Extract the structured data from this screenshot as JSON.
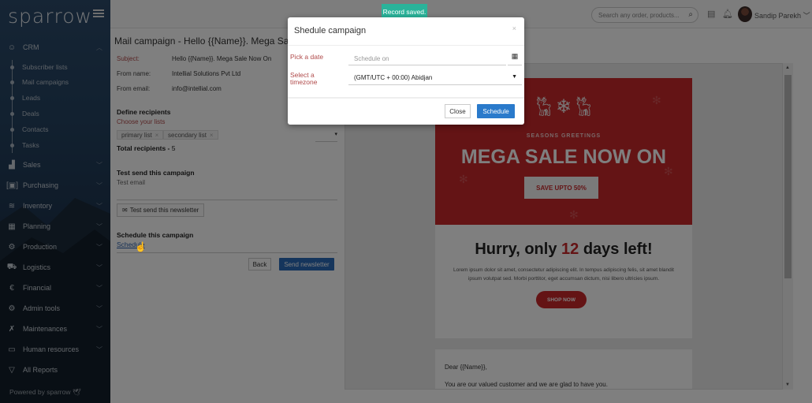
{
  "sidebar": {
    "brand": "sparrow",
    "crm": {
      "label": "CRM",
      "icon": "crm-icon"
    },
    "crm_items": [
      {
        "label": "Subscriber lists"
      },
      {
        "label": "Mail campaigns"
      },
      {
        "label": "Leads"
      },
      {
        "label": "Deals"
      },
      {
        "label": "Contacts"
      },
      {
        "label": "Tasks"
      }
    ],
    "sections": [
      {
        "label": "Sales",
        "icon": "chart-bar-icon"
      },
      {
        "label": "Purchasing",
        "icon": "barcode-scan-icon"
      },
      {
        "label": "Inventory",
        "icon": "database-icon"
      },
      {
        "label": "Planning",
        "icon": "calendar-icon"
      },
      {
        "label": "Production",
        "icon": "gears-icon"
      },
      {
        "label": "Logistics",
        "icon": "truck-icon"
      },
      {
        "label": "Financial",
        "icon": "euro-icon"
      },
      {
        "label": "Admin tools",
        "icon": "cog-icon"
      },
      {
        "label": "Maintenances",
        "icon": "tools-icon"
      },
      {
        "label": "Human resources",
        "icon": "id-card-icon"
      }
    ],
    "all_reports": "All Reports",
    "powered_by": "Powered by sparrow"
  },
  "topbar": {
    "search_placeholder": "Search any order, products...",
    "user_name": "Sandip Parekh"
  },
  "campaign": {
    "title": "Mail campaign - Hello {{Name}}. Mega Sale N",
    "subject_label": "Subject:",
    "subject": "Hello {{Name}}. Mega Sale Now On",
    "from_name_label": "From name:",
    "from_name": "Intellial Solutions Pvt Ltd",
    "from_email_label": "From email:",
    "from_email": "info@intellial.com",
    "define_recipients": "Define recipients",
    "choose_lists": "Choose your lists",
    "lists": [
      "primary list",
      "secondary list"
    ],
    "total_recipients_label": "Total recipients -",
    "total_recipients": "5",
    "test_send_heading": "Test send this campaign",
    "test_email_label": "Test email",
    "test_send_button": "Test send this newsletter",
    "schedule_heading": "Schedule this campaign",
    "schedule_link": "Schedule",
    "back_button": "Back",
    "send_button": "Send newsletter"
  },
  "preview": {
    "greeting_banner": "SEASONS GREETINGS",
    "headline": "MEGA SALE NOW ON",
    "save_button": "SAVE UPTO 50%",
    "hurry_prefix": "Hurry, only ",
    "hurry_number": "12",
    "hurry_suffix": " days left!",
    "lorem": "Lorem ipsum dolor sit amet, consectetur adipiscing elit. In tempus adipiscing felis, sit amet blandit ipsum volutpat sed. Morbi porttitor, eget accumsan dictum, nisi libero ultricies ipsum.",
    "shop_button": "SHOP NOW",
    "dear": "Dear {{Name}},",
    "valued": "You are our valued customer and we are glad to have you."
  },
  "toast": "Record saved.",
  "modal": {
    "title": "Shedule campaign",
    "date_label": "Pick a date",
    "date_placeholder": "Schedule on",
    "timezone_label": "Select a timezone",
    "timezone_value": "(GMT/UTC + 00:00) Abidjan",
    "close_button": "Close",
    "schedule_button": "Schedule"
  },
  "colors": {
    "accent": "#2a6ab8",
    "toast": "#2ab39a",
    "brand_red": "#c8282a"
  }
}
